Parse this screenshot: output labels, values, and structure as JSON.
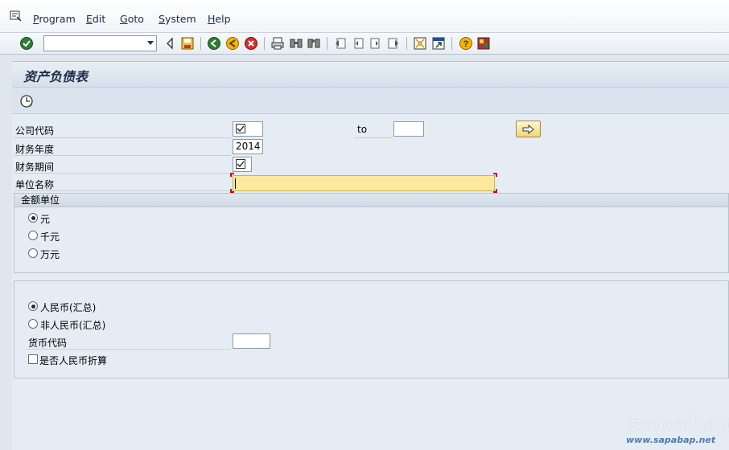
{
  "menu": {
    "items": [
      {
        "label": "Program",
        "accel": "P",
        "rest": "rogram"
      },
      {
        "label": "Edit",
        "accel": "E",
        "rest": "dit"
      },
      {
        "label": "Goto",
        "accel": "G",
        "rest": "oto"
      },
      {
        "label": "System",
        "accel": "S",
        "rest": "ystem"
      },
      {
        "label": "Help",
        "accel": "H",
        "rest": "elp"
      }
    ]
  },
  "toolbar": {
    "command_field": {
      "value": ""
    },
    "icons": [
      "enter-icon",
      "back-arrow-icon",
      "save-icon",
      "back-icon",
      "exit-icon",
      "cancel-icon",
      "print-icon",
      "find-icon",
      "find-next-icon",
      "first-page-icon",
      "previous-page-icon",
      "next-page-icon",
      "last-page-icon",
      "create-session-icon",
      "shortcut-icon",
      "help-icon",
      "customize-layout-icon"
    ]
  },
  "screen": {
    "title": "资产负债表",
    "app_toolbar": {
      "icons": [
        "execute-icon"
      ]
    }
  },
  "form": {
    "company_code": {
      "label": "公司代码",
      "checked": true,
      "to_label": "to",
      "to_value": ""
    },
    "fiscal_year": {
      "label": "财务年度",
      "value": "2014"
    },
    "period": {
      "label": "财务期间",
      "checked": true
    },
    "unit_name": {
      "label": "单位名称",
      "value": ""
    }
  },
  "amount_unit": {
    "title": "金额单位",
    "options": [
      {
        "label": "元",
        "selected": true
      },
      {
        "label": "千元",
        "selected": false
      },
      {
        "label": "万元",
        "selected": false
      }
    ]
  },
  "currency_group": {
    "options": [
      {
        "label": "人民币(汇总)",
        "selected": true
      },
      {
        "label": "非人民币(汇总)",
        "selected": false
      }
    ],
    "currency_code": {
      "label": "货币代码",
      "value": ""
    },
    "rmb_convert": {
      "label": "是否人民币折算",
      "checked": false
    }
  },
  "watermark": {
    "logo": "sapabap",
    "url": "www.sapabap.net"
  },
  "colors": {
    "required_field": "#fde99e",
    "background": "#e6ecf3",
    "title_text": "#1e2d48"
  }
}
